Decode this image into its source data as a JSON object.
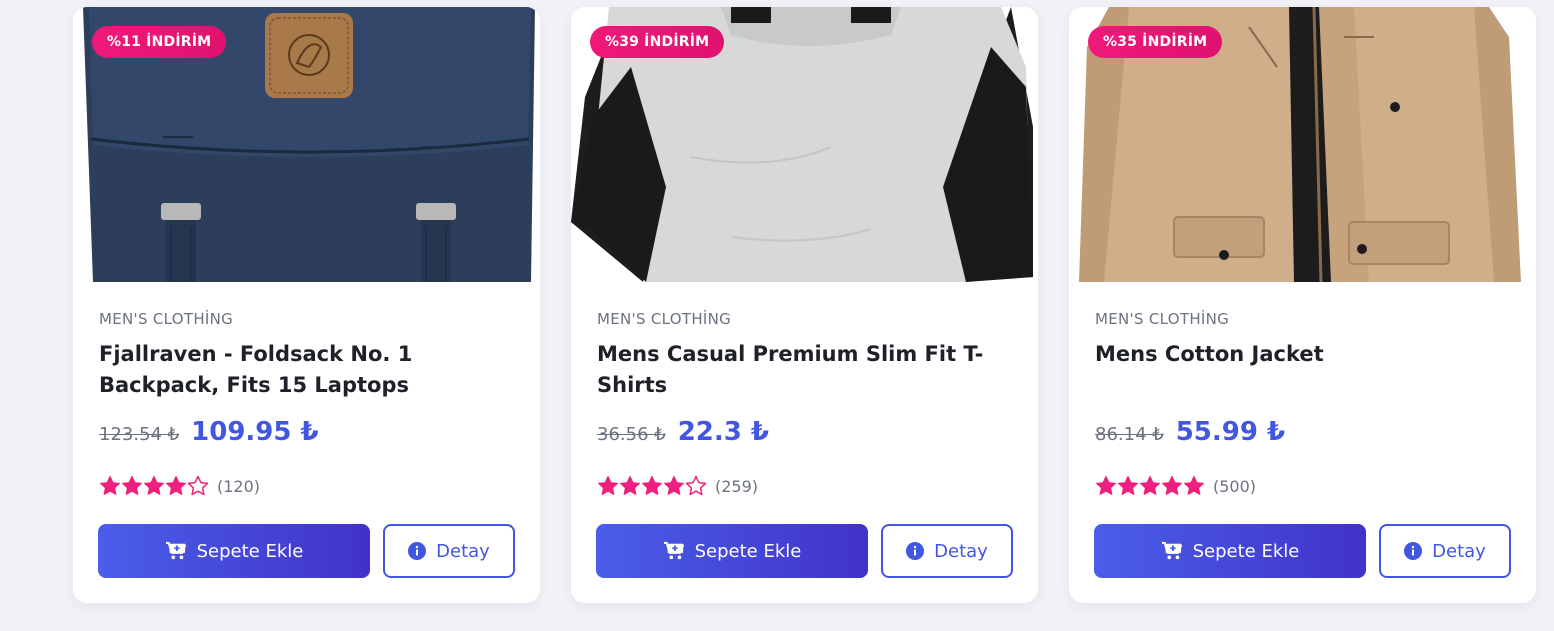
{
  "colors": {
    "accent": "#4156e1",
    "badge": "#f0197a",
    "star": "#ef1f7e"
  },
  "products": [
    {
      "badge": "%11 İNDİRİM",
      "category": "MEN'S CLOTHİNG",
      "title": "Fjallraven - Foldsack No. 1 Backpack, Fits 15 Laptops",
      "old_price": "123.54 ₺",
      "new_price": "109.95 ₺",
      "rating": 4,
      "review_count": "(120)",
      "cart_label": "Sepete Ekle",
      "detail_label": "Detay"
    },
    {
      "badge": "%39 İNDİRİM",
      "category": "MEN'S CLOTHİNG",
      "title": "Mens Casual Premium Slim Fit T-Shirts",
      "old_price": "36.56 ₺",
      "new_price": "22.3 ₺",
      "rating": 4,
      "review_count": "(259)",
      "cart_label": "Sepete Ekle",
      "detail_label": "Detay"
    },
    {
      "badge": "%35 İNDİRİM",
      "category": "MEN'S CLOTHİNG",
      "title": "Mens Cotton Jacket",
      "old_price": "86.14 ₺",
      "new_price": "55.99 ₺",
      "rating": 5,
      "review_count": "(500)",
      "cart_label": "Sepete Ekle",
      "detail_label": "Detay"
    }
  ]
}
